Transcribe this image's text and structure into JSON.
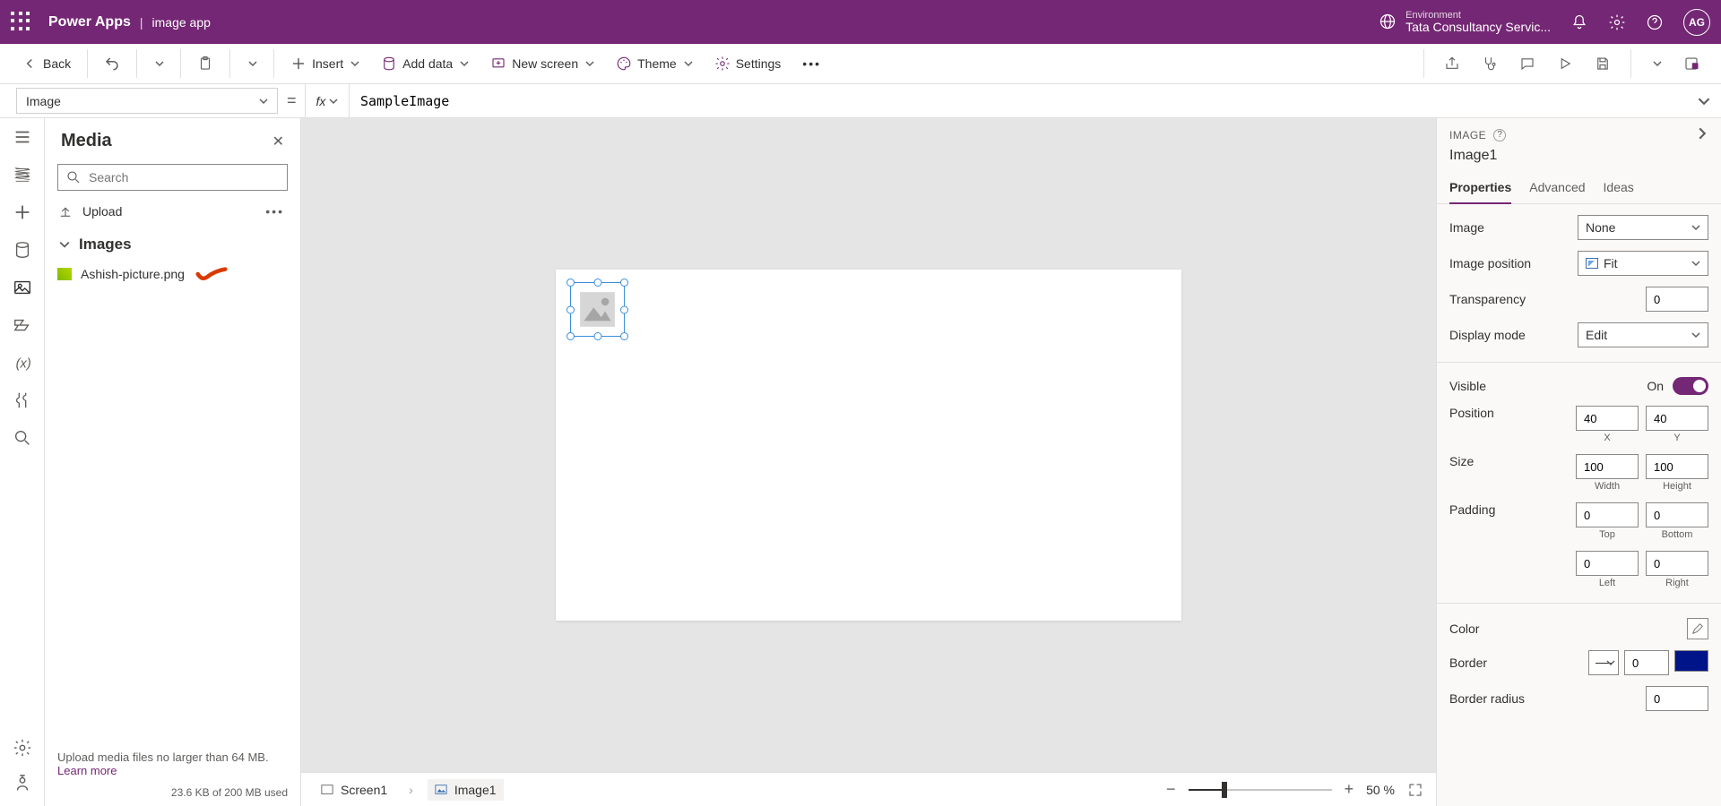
{
  "header": {
    "brand": "Power Apps",
    "app_name": "image app",
    "env_label": "Environment",
    "env_name": "Tata Consultancy Servic...",
    "avatar_initials": "AG"
  },
  "cmd": {
    "back": "Back",
    "insert": "Insert",
    "add_data": "Add data",
    "new_screen": "New screen",
    "theme": "Theme",
    "settings": "Settings"
  },
  "formula": {
    "property": "Image",
    "value": "SampleImage"
  },
  "media": {
    "title": "Media",
    "search_placeholder": "Search",
    "upload": "Upload",
    "section": "Images",
    "file": "Ashish-picture.png",
    "hint": "Upload media files no larger than 64 MB.",
    "learn": "Learn more",
    "usage": "23.6 KB of 200 MB used"
  },
  "bottom": {
    "screen": "Screen1",
    "control": "Image1",
    "zoom": "50  %"
  },
  "rp": {
    "type": "IMAGE",
    "name": "Image1",
    "tabs": {
      "properties": "Properties",
      "advanced": "Advanced",
      "ideas": "Ideas"
    },
    "labels": {
      "image": "Image",
      "image_position": "Image position",
      "transparency": "Transparency",
      "display_mode": "Display mode",
      "visible": "Visible",
      "on": "On",
      "position": "Position",
      "x": "X",
      "y": "Y",
      "size": "Size",
      "width": "Width",
      "height": "Height",
      "padding": "Padding",
      "top": "Top",
      "bottom": "Bottom",
      "left": "Left",
      "right": "Right",
      "color": "Color",
      "border": "Border",
      "border_radius": "Border radius"
    },
    "vals": {
      "image": "None",
      "image_position": "Fit",
      "transparency": "0",
      "display_mode": "Edit",
      "x": "40",
      "y": "40",
      "width": "100",
      "height": "100",
      "pad_top": "0",
      "pad_bottom": "0",
      "pad_left": "0",
      "pad_right": "0",
      "border_w": "0",
      "border_radius": "0"
    }
  }
}
